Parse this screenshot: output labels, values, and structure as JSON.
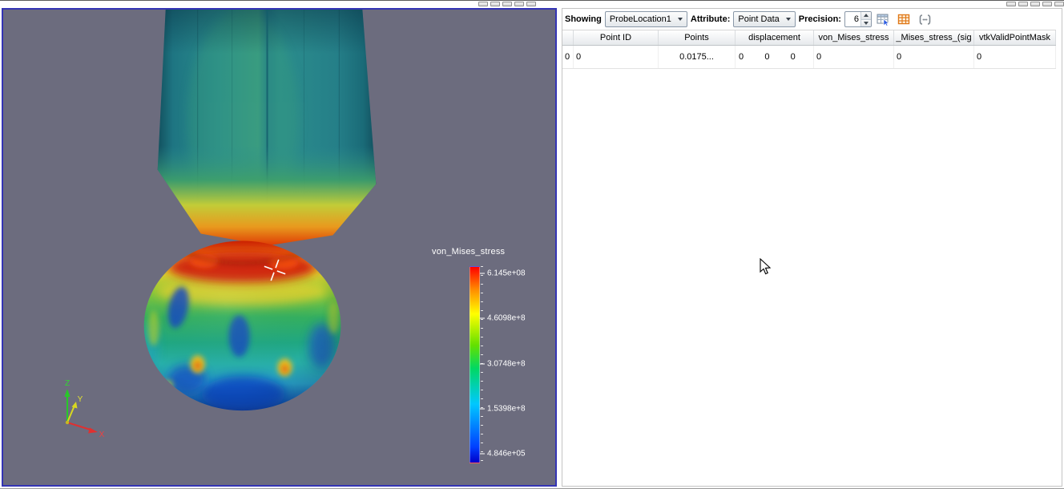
{
  "render_view": {
    "legend": {
      "title": "von_Mises_stress",
      "labels": [
        "6.145e+08",
        "4.6098e+8",
        "3.0748e+8",
        "1.5398e+8",
        "4.846e+05"
      ]
    },
    "axes": {
      "x_label": "X",
      "y_label": "Y",
      "z_label": "Z"
    },
    "colors": {
      "background": "#6c6c7e",
      "view_border": "#3434b4",
      "axis_x": "#e03030",
      "axis_y": "#d8d820",
      "axis_z": "#28c828",
      "legend_top": "#ff0000",
      "legend_bottom": "#0000c8"
    }
  },
  "spreadsheet": {
    "toolbar": {
      "showing_label": "Showing",
      "showing_value": "ProbeLocation1",
      "attribute_label": "Attribute:",
      "attribute_value": "Point Data",
      "precision_label": "Precision:",
      "precision_value": "6",
      "icon_names": [
        "show-only-selected",
        "toggle-column-visibility",
        "toggle-field-data"
      ]
    },
    "table": {
      "columns": [
        "Point ID",
        "Points",
        "displacement",
        "von_Mises_stress",
        "_Mises_stress_(sig",
        "vtkValidPointMask"
      ],
      "rows": [
        {
          "index": "0",
          "point_id": "0",
          "points": "0.0175...",
          "displacement": [
            "0",
            "0",
            "0"
          ],
          "von_mises_stress": "0",
          "mises_stress_sig": "0",
          "vtk_valid_point_mask": "0"
        }
      ]
    }
  }
}
